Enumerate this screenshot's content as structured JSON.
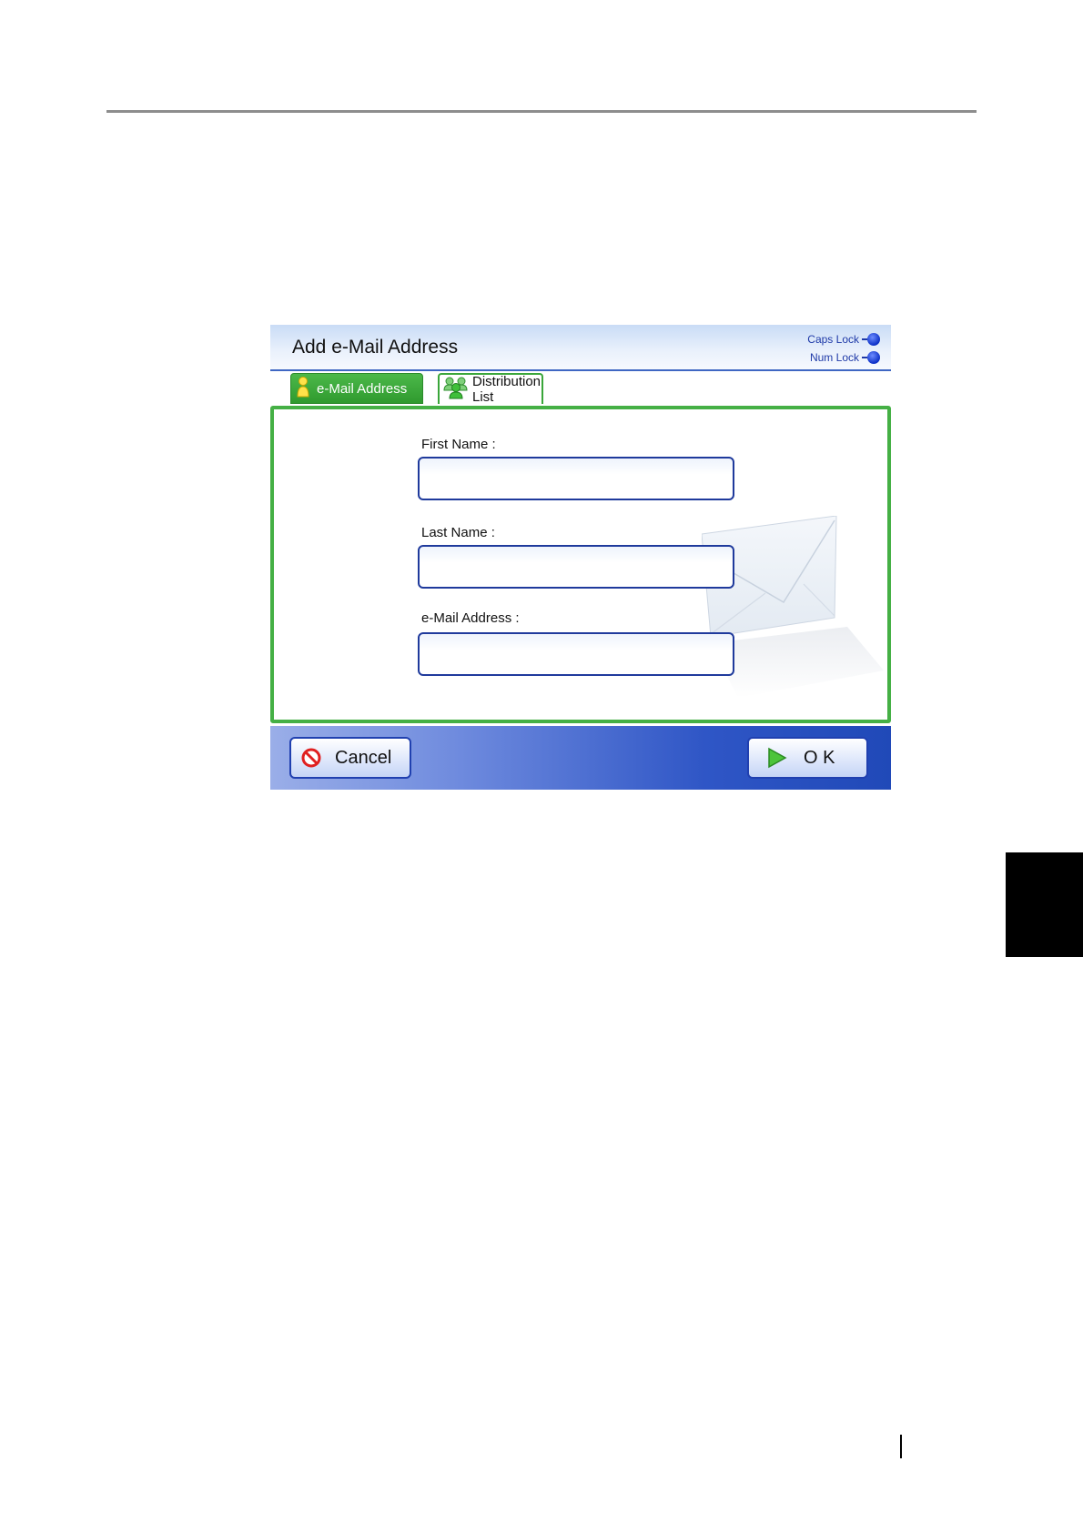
{
  "dialog": {
    "title": "Add e-Mail Address",
    "indicators": {
      "caps_lock": "Caps Lock",
      "num_lock": "Num Lock"
    }
  },
  "tabs": [
    {
      "label": "e-Mail Address",
      "icon": "person-icon",
      "active": true
    },
    {
      "label": "Distribution List",
      "icon": "group-icon",
      "active": false
    }
  ],
  "form": {
    "first_name": {
      "label": "First Name :",
      "value": ""
    },
    "last_name": {
      "label": "Last Name :",
      "value": ""
    },
    "email": {
      "label": "e-Mail Address :",
      "value": ""
    }
  },
  "footer": {
    "cancel_label": "Cancel",
    "ok_label": "O K"
  },
  "colors": {
    "accent_green": "#45b045",
    "accent_blue": "#2049b8",
    "field_border": "#1f3a9c"
  }
}
